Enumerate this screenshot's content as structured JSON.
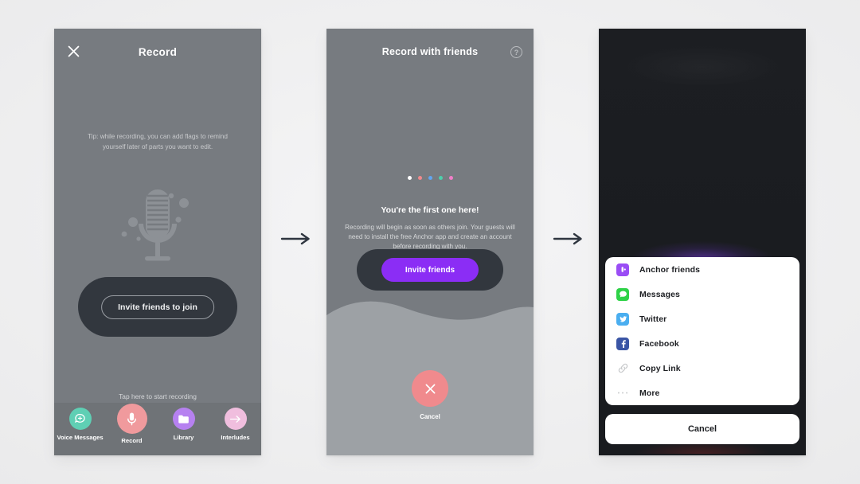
{
  "page": {
    "background_color": "#f1f1f2",
    "flow_arrow_color": "#2f3640"
  },
  "screen1": {
    "name": "record-screen",
    "screen_bg": "#777b80",
    "close_icon": "close-icon",
    "title": "Record",
    "tip_text": "Tip: while recording, you can add flags to remind yourself later of parts you want to edit.",
    "illustration": "microphone-illustration",
    "cta_card_color": "#32373e",
    "cta_button_label": "Invite friends to join",
    "hint_text": "Tap here to start recording",
    "down_arrow_icon": "arrow-down-icon",
    "tabbar_bg": "#6f7377",
    "tabs": [
      {
        "label": "Voice Messages",
        "icon": "speech-bubble-plus-icon",
        "color": "#5fcfb4"
      },
      {
        "label": "Record",
        "icon": "microphone-icon",
        "color": "#f09a9d"
      },
      {
        "label": "Library",
        "icon": "folder-icon",
        "color": "#b681f0"
      },
      {
        "label": "Interludes",
        "icon": "arrow-right-icon",
        "color": "#f0bede"
      }
    ]
  },
  "screen2": {
    "name": "record-with-friends-screen",
    "screen_bg": "#777b80",
    "title": "Record with friends",
    "help_icon": "help-circle-icon",
    "help_label": "?",
    "dots": [
      {
        "color": "#ffffff"
      },
      {
        "color": "#f08a8d"
      },
      {
        "color": "#62a6f0"
      },
      {
        "color": "#4ecfab"
      },
      {
        "color": "#f07fc8"
      }
    ],
    "heading": "You're the first one here!",
    "body_text": "Recording will begin as soon as others join. Your guests will need to install the free Anchor app and create an account before recording with you.",
    "cta_card_color": "#32373e",
    "cta_button_label": "Invite friends",
    "cta_button_color": "#8b2df5",
    "wave_color": "#9da1a5",
    "cancel_icon": "close-icon",
    "cancel_circle_color": "#f08a8d",
    "cancel_label": "Cancel"
  },
  "screen3": {
    "name": "share-sheet-screen",
    "screen_bg": "#1b1d21",
    "share_items": [
      {
        "label": "Anchor friends",
        "icon": "anchor-app-icon",
        "color": "#9a4df5"
      },
      {
        "label": "Messages",
        "icon": "messages-icon",
        "color": "#2ed247"
      },
      {
        "label": "Twitter",
        "icon": "twitter-icon",
        "color": "#4aaef0"
      },
      {
        "label": "Facebook",
        "icon": "facebook-icon",
        "color": "#3a55a5"
      },
      {
        "label": "Copy Link",
        "icon": "link-icon",
        "color": "#c8cacc"
      },
      {
        "label": "More",
        "icon": "ellipsis-icon",
        "color": "#c8cacc"
      }
    ],
    "cancel_label": "Cancel"
  }
}
